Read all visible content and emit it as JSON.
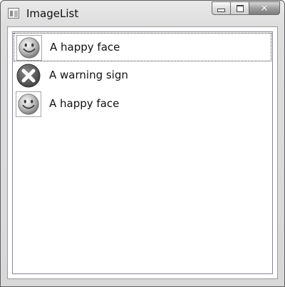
{
  "window": {
    "title": "ImageList"
  },
  "caption_buttons": {
    "minimize": "minimize-icon",
    "maximize": "maximize-icon",
    "close": "close-icon"
  },
  "list": {
    "items": [
      {
        "label": "A happy face",
        "icon": "happy-face-icon",
        "focused": true
      },
      {
        "label": "A warning sign",
        "icon": "warning-sign-icon",
        "focused": false
      },
      {
        "label": "A happy face",
        "icon": "happy-face-icon",
        "focused": false
      }
    ]
  }
}
